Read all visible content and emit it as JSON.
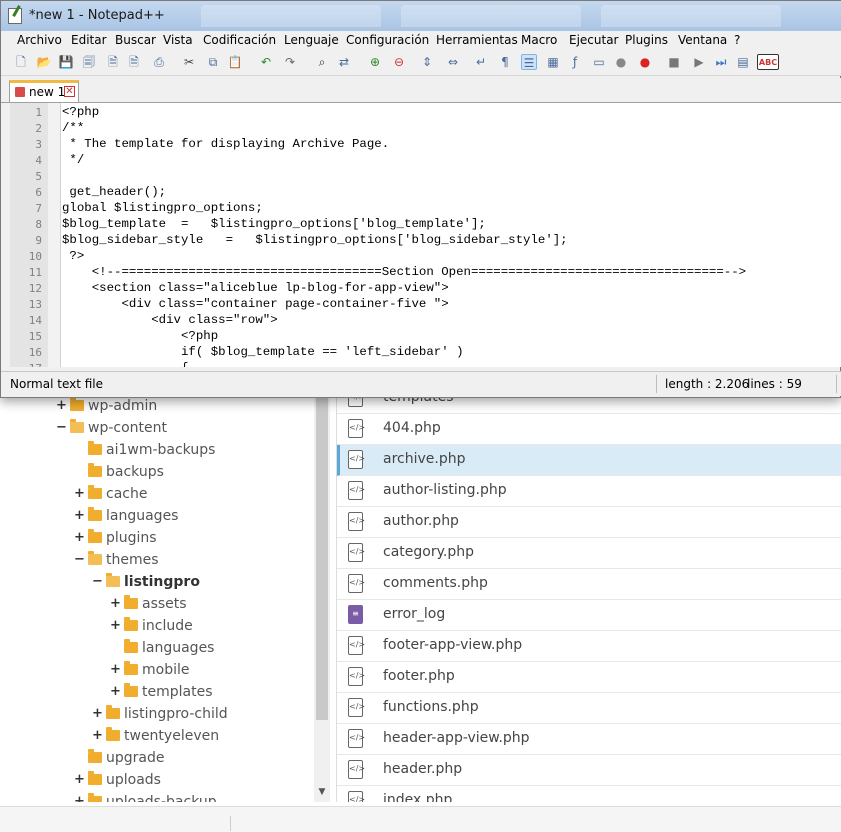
{
  "window": {
    "title": "*new 1 - Notepad++"
  },
  "menu": [
    "Archivo",
    "Editar",
    "Buscar",
    "Vista",
    "Codificación",
    "Lenguaje",
    "Configuración",
    "Herramientas",
    "Macro",
    "Ejecutar",
    "Plugins",
    "Ventana",
    "?"
  ],
  "toolbar": {
    "icons": [
      "new-file-icon",
      "open-file-icon",
      "save-icon",
      "save-all-icon",
      "close-icon",
      "close-all-icon",
      "print-icon",
      "cut-icon",
      "copy-icon",
      "paste-icon",
      "undo-icon",
      "redo-icon",
      "find-icon",
      "replace-icon",
      "zoom-in-icon",
      "zoom-out-icon",
      "sync-vertical-icon",
      "sync-horizontal-icon",
      "word-wrap-icon",
      "show-all-chars-icon",
      "indent-guide-icon",
      "document-map-icon",
      "function-list-icon",
      "folder-workspace-icon",
      "monitoring-icon",
      "record-macro-icon",
      "stop-macro-icon",
      "play-macro-icon",
      "run-macro-multiple-icon",
      "save-macro-icon",
      "spell-check-icon"
    ],
    "spell_check_label": "ABC"
  },
  "tab": {
    "label": "new 1",
    "close_glyph": "✕"
  },
  "editor": {
    "lines": [
      "<?php",
      "/**",
      " * The template for displaying Archive Page.",
      " */",
      "",
      " get_header();",
      "global $listingpro_options;",
      "$blog_template  =   $listingpro_options['blog_template'];",
      "$blog_sidebar_style   =   $listingpro_options['blog_sidebar_style'];",
      " ?>",
      "    <!--===================================Section Open==================================-->",
      "    <section class=\"aliceblue lp-blog-for-app-view\">",
      "        <div class=\"container page-container-five \">",
      "            <div class=\"row\">",
      "                <?php",
      "                if( $blog_template == 'left_sidebar' )",
      "                {"
    ]
  },
  "status": {
    "doc_type": "Normal text file",
    "length": "length : 2.206",
    "lines": "lines : 59"
  },
  "tree": [
    {
      "name": "wp-admin",
      "toggle": "+",
      "indent": 0
    },
    {
      "name": "wp-content",
      "toggle": "−",
      "indent": 0,
      "open": true
    },
    {
      "name": "ai1wm-backups",
      "toggle": "",
      "indent": 1
    },
    {
      "name": "backups",
      "toggle": "",
      "indent": 1
    },
    {
      "name": "cache",
      "toggle": "+",
      "indent": 1
    },
    {
      "name": "languages",
      "toggle": "+",
      "indent": 1
    },
    {
      "name": "plugins",
      "toggle": "+",
      "indent": 1
    },
    {
      "name": "themes",
      "toggle": "−",
      "indent": 1,
      "open": true
    },
    {
      "name": "listingpro",
      "toggle": "−",
      "indent": 2,
      "open": true,
      "bold": true
    },
    {
      "name": "assets",
      "toggle": "+",
      "indent": 3
    },
    {
      "name": "include",
      "toggle": "+",
      "indent": 3
    },
    {
      "name": "languages",
      "toggle": "",
      "indent": 3
    },
    {
      "name": "mobile",
      "toggle": "+",
      "indent": 3
    },
    {
      "name": "templates",
      "toggle": "+",
      "indent": 3
    },
    {
      "name": "listingpro-child",
      "toggle": "+",
      "indent": 2
    },
    {
      "name": "twentyeleven",
      "toggle": "+",
      "indent": 2
    },
    {
      "name": "upgrade",
      "toggle": "",
      "indent": 1
    },
    {
      "name": "uploads",
      "toggle": "+",
      "indent": 1
    },
    {
      "name": "uploads-backup",
      "toggle": "+",
      "indent": 1
    }
  ],
  "files": [
    {
      "name": "templates",
      "icon": "code-file-icon"
    },
    {
      "name": "404.php",
      "icon": "code-file-icon"
    },
    {
      "name": "archive.php",
      "icon": "code-file-icon",
      "selected": true
    },
    {
      "name": "author-listing.php",
      "icon": "code-file-icon"
    },
    {
      "name": "author.php",
      "icon": "code-file-icon"
    },
    {
      "name": "category.php",
      "icon": "code-file-icon"
    },
    {
      "name": "comments.php",
      "icon": "code-file-icon"
    },
    {
      "name": "error_log",
      "icon": "text-document-icon"
    },
    {
      "name": "footer-app-view.php",
      "icon": "code-file-icon"
    },
    {
      "name": "footer.php",
      "icon": "code-file-icon"
    },
    {
      "name": "functions.php",
      "icon": "code-file-icon"
    },
    {
      "name": "header-app-view.php",
      "icon": "code-file-icon"
    },
    {
      "name": "header.php",
      "icon": "code-file-icon"
    },
    {
      "name": "index.php",
      "icon": "code-file-icon"
    }
  ]
}
